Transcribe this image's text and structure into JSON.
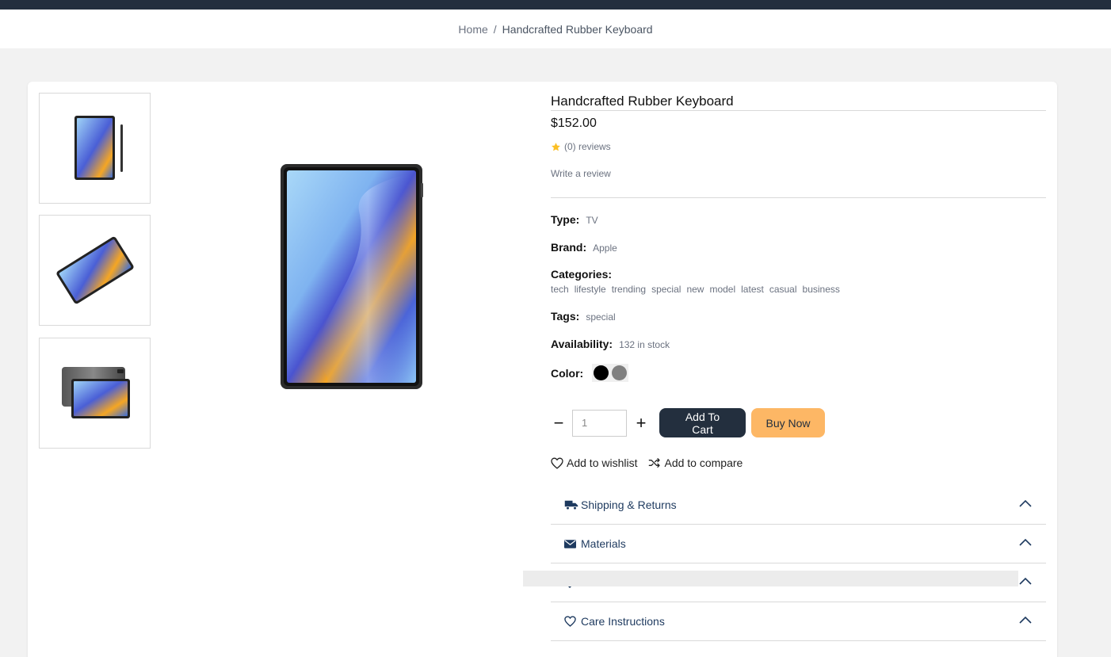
{
  "breadcrumb": {
    "home": "Home",
    "separator": "/",
    "current": "Handcrafted Rubber Keyboard"
  },
  "product": {
    "title": "Handcrafted Rubber Keyboard",
    "price": "$152.00",
    "reviews": "(0) reviews",
    "write_review": "Write a review",
    "type_label": "Type:",
    "type_value": "TV",
    "brand_label": "Brand:",
    "brand_value": "Apple",
    "categories_label": "Categories:",
    "categories": [
      "tech",
      "lifestyle",
      "trending",
      "special",
      "new",
      "model",
      "latest",
      "casual",
      "business"
    ],
    "tags_label": "Tags:",
    "tags_value": "special",
    "availability_label": "Availability:",
    "availability_value": "132 in stock",
    "color_label": "Color:",
    "colors": [
      "#000000",
      "#808080"
    ],
    "quantity_value": "1",
    "quantity_minus": "−",
    "quantity_plus": "+"
  },
  "actions": {
    "add_to_cart": "Add To Cart",
    "buy_now": "Buy Now",
    "wishlist": "Add to wishlist",
    "compare": "Add to compare"
  },
  "accordion": [
    {
      "label": "Shipping & Returns",
      "icon": "truck-icon"
    },
    {
      "label": "Materials",
      "icon": "envelope-icon"
    },
    {
      "label": "Dimensions",
      "icon": "diamond-icon"
    },
    {
      "label": "Care Instructions",
      "icon": "heart-icon"
    }
  ],
  "colors_theme": {
    "dark": "#232f3e",
    "accent": "#fdb765",
    "star": "#fbbf24",
    "accent_text": "#1e3a5f"
  }
}
